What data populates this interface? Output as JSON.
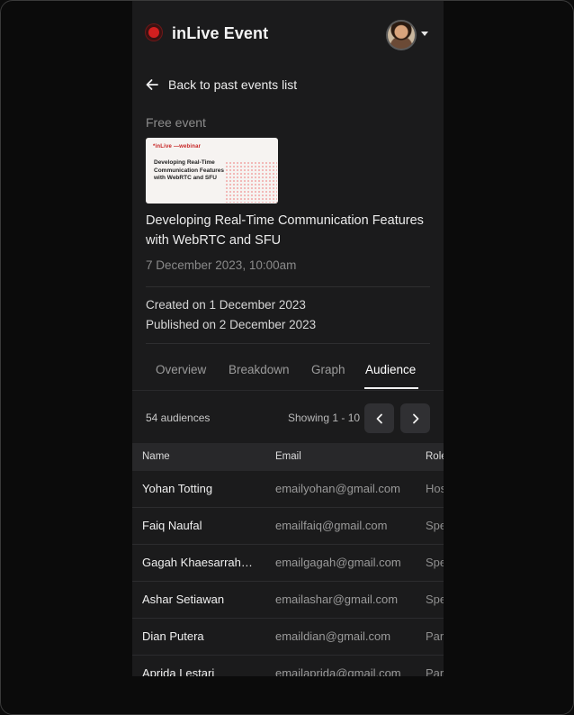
{
  "header": {
    "app_title": "inLive Event",
    "rec_icon": "record-dot-icon",
    "avatar_icon": "user-avatar",
    "menu_icon": "caret-down-icon"
  },
  "back": {
    "label": "Back to past events list",
    "icon": "arrow-left-icon"
  },
  "event": {
    "badge": "Free event",
    "thumbnail": {
      "brand": "*inLive —webinar",
      "title": "Developing Real-Time Communication Features with WebRTC and SFU"
    },
    "title": "Developing Real-Time Communication Features with WebRTC and SFU",
    "datetime": "7 December 2023, 10:00am",
    "created": "Created on 1 December 2023",
    "published": "Published on 2 December 2023"
  },
  "tabs": [
    {
      "label": "Overview",
      "active": false
    },
    {
      "label": "Breakdown",
      "active": false
    },
    {
      "label": "Graph",
      "active": false
    },
    {
      "label": "Audience",
      "active": true
    }
  ],
  "audience": {
    "count_label": "54 audiences",
    "showing_label": "Showing 1 - 10",
    "prev_icon": "chevron-left-icon",
    "next_icon": "chevron-right-icon",
    "columns": [
      "Name",
      "Email",
      "Role"
    ],
    "rows": [
      {
        "name": "Yohan Totting",
        "email": "emailyohan@gmail.com",
        "role": "Host"
      },
      {
        "name": "Faiq Naufal",
        "email": "emailfaiq@gmail.com",
        "role": "Speaker"
      },
      {
        "name": "Gagah Khaesarrahman",
        "email": "emailgagah@gmail.com",
        "role": "Speaker"
      },
      {
        "name": "Ashar Setiawan",
        "email": "emailashar@gmail.com",
        "role": "Speaker"
      },
      {
        "name": "Dian Putera",
        "email": "emaildian@gmail.com",
        "role": "Participant"
      },
      {
        "name": "Aprida Lestari",
        "email": "emailaprida@gmail.com",
        "role": "Participant"
      }
    ]
  },
  "colors": {
    "background": "#1b1b1c",
    "accent_red": "#d21f1f",
    "text_muted": "#8c8c8c"
  }
}
